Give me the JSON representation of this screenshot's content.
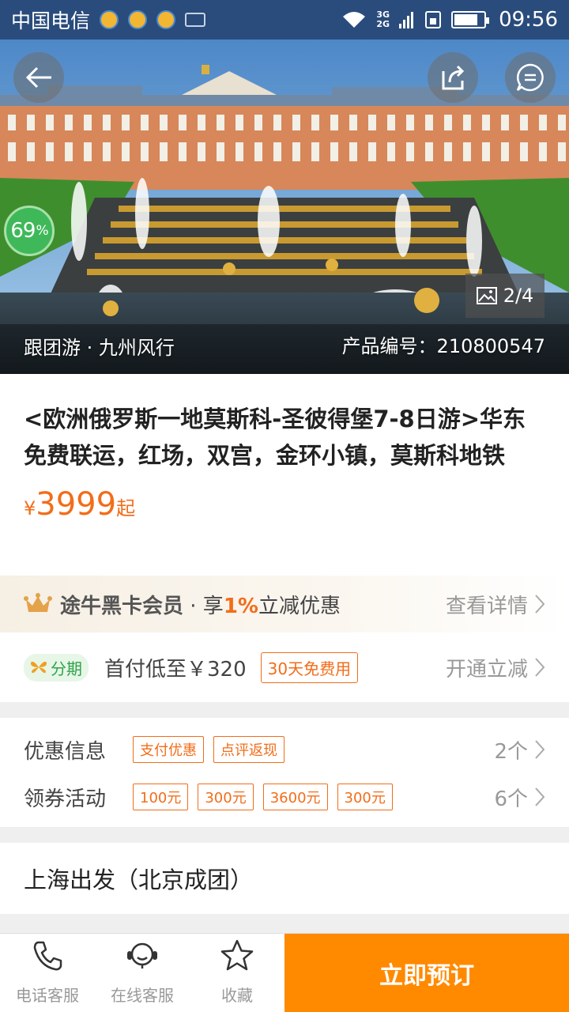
{
  "status_bar": {
    "carrier": "中国电信",
    "network": [
      "3G",
      "2G"
    ],
    "time": "09:56"
  },
  "hero": {
    "discount_pct": "69",
    "pct_sign": "%",
    "pager": "2/4",
    "tour_type": "跟团游 · 九州风行",
    "product_no": "产品编号：210800547"
  },
  "product": {
    "title": "<欧洲俄罗斯一地莫斯科-圣彼得堡7-8日游>华东免费联运，红场，双宫，金环小镇，莫斯科地铁",
    "price_currency": "¥",
    "price_value": "3999",
    "price_suffix": "起"
  },
  "member": {
    "name": "途牛黑卡会员",
    "sep": " · 享",
    "percent": "1%",
    "benefit": "立减优惠",
    "detail_label": "查看详情"
  },
  "installment": {
    "badge": "分期",
    "first_pay": "首付低至￥320",
    "free_tag": "30天免费用",
    "action": "开通立减"
  },
  "promotions": {
    "discount_label": "优惠信息",
    "discount_chips": [
      "支付优惠",
      "点评返现"
    ],
    "discount_count": "2个",
    "coupon_label": "领券活动",
    "coupon_chips": [
      "100元",
      "300元",
      "3600元",
      "300元"
    ],
    "coupon_count": "6个"
  },
  "departure": {
    "text": "上海出发（北京成团）"
  },
  "bottom_bar": {
    "phone": "电话客服",
    "online": "在线客服",
    "favorite": "收藏",
    "book": "立即预订"
  },
  "colors": {
    "accent": "#f26d1a",
    "book_button": "#ff8a00",
    "status_bar": "#2a4c7c"
  }
}
